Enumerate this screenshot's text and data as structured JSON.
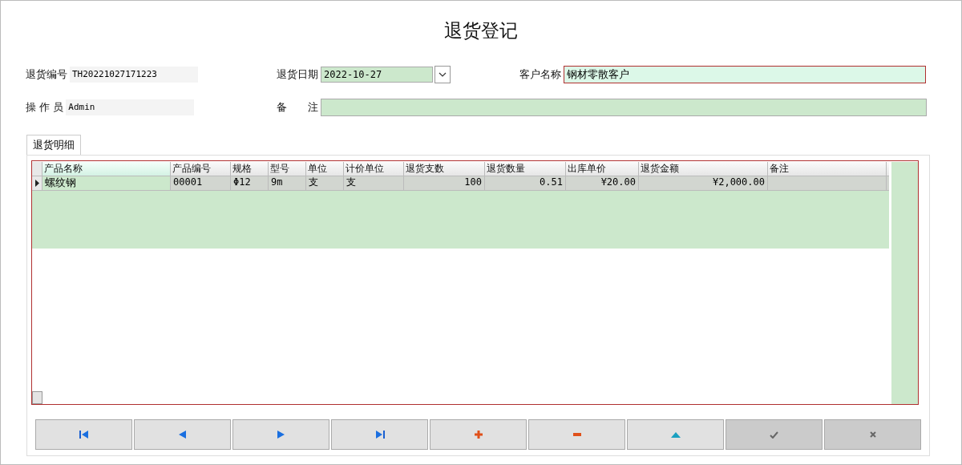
{
  "title": "退货登记",
  "fields": [
    {
      "label": "退货编号",
      "value": "TH20221027171223",
      "kind": "readonly"
    },
    {
      "label": "退货日期",
      "value": "2022-10-27",
      "kind": "date"
    },
    {
      "label": "客户名称",
      "value": "钢材零散客户",
      "kind": "required"
    },
    {
      "label": "操 作 员",
      "value": "Admin",
      "kind": "readonly"
    },
    {
      "label": "备　　注",
      "kind": "text"
    }
  ],
  "tabs": [
    {
      "label": "退货明细",
      "selected": true
    }
  ],
  "table": {
    "columns": [
      {
        "label": "产品名称"
      },
      {
        "label": "产品编号"
      },
      {
        "label": "规格"
      },
      {
        "label": "型号"
      },
      {
        "label": "单位"
      },
      {
        "label": "计价单位"
      },
      {
        "label": "退货支数"
      },
      {
        "label": "退货数量"
      },
      {
        "label": "出库单价"
      },
      {
        "label": "退货金额"
      },
      {
        "label": "备注"
      }
    ],
    "rows": [
      {
        "selected": true,
        "cells": [
          "螺纹钢",
          "00001",
          "Φ12",
          "9m",
          "支",
          "支",
          "100",
          "0.51",
          "¥20.00",
          "¥2,000.00"
        ]
      }
    ]
  },
  "buttons": [
    {
      "kind": "first",
      "disabled": false
    },
    {
      "kind": "prev",
      "disabled": false
    },
    {
      "kind": "next",
      "disabled": false
    },
    {
      "kind": "last",
      "disabled": false
    },
    {
      "kind": "add",
      "disabled": false
    },
    {
      "kind": "remove",
      "disabled": false
    },
    {
      "kind": "up",
      "disabled": false
    },
    {
      "kind": "confirm",
      "disabled": true
    },
    {
      "kind": "cancel",
      "disabled": true
    }
  ]
}
